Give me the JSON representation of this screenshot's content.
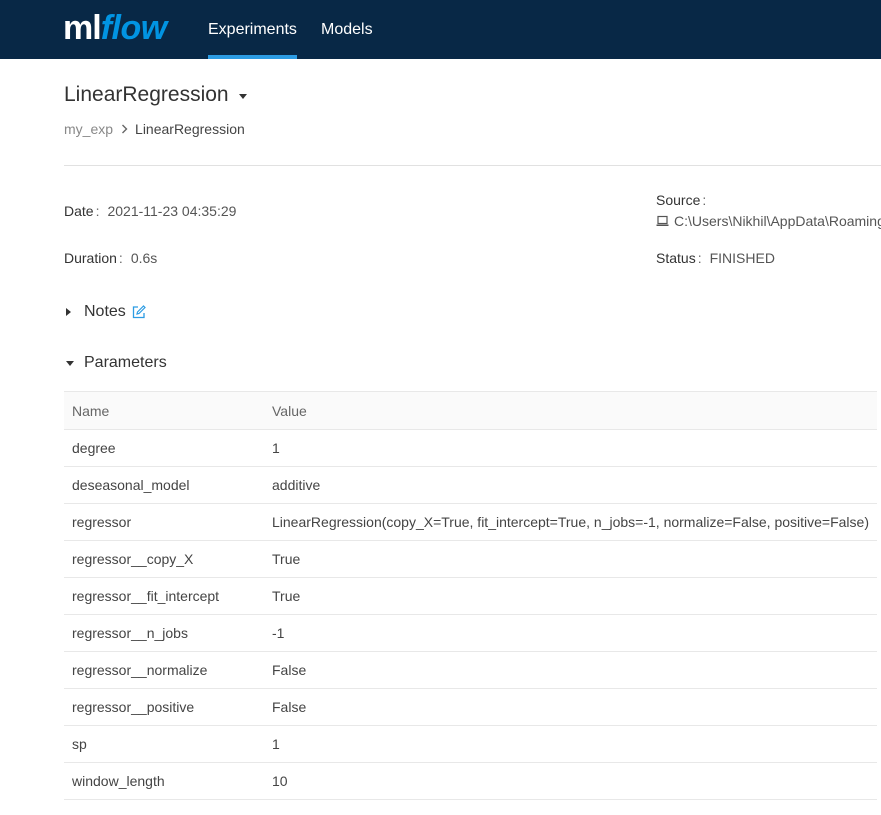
{
  "header": {
    "logo_ml": "ml",
    "logo_flow": "flow",
    "nav": [
      {
        "label": "Experiments",
        "active": true
      },
      {
        "label": "Models",
        "active": false
      }
    ],
    "bg_color": "#082846",
    "accent_color": "#2c9ce3"
  },
  "run": {
    "title": "LinearRegression",
    "breadcrumb": {
      "parent": "my_exp",
      "current": "LinearRegression"
    }
  },
  "metadata": {
    "date_label": "Date",
    "date_value": "2021-11-23 04:35:29",
    "duration_label": "Duration",
    "duration_value": "0.6s",
    "source_label": "Source",
    "source_value": "C:\\Users\\Nikhil\\AppData\\Roaming",
    "status_label": "Status",
    "status_value": "FINISHED",
    "separator": ":"
  },
  "sections": {
    "notes_label": "Notes",
    "parameters_label": "Parameters"
  },
  "parameters": {
    "columns": [
      "Name",
      "Value"
    ],
    "rows": [
      {
        "name": "degree",
        "value": "1"
      },
      {
        "name": "deseasonal_model",
        "value": "additive"
      },
      {
        "name": "regressor",
        "value": "LinearRegression(copy_X=True, fit_intercept=True, n_jobs=-1, normalize=False, positive=False)"
      },
      {
        "name": "regressor__copy_X",
        "value": "True"
      },
      {
        "name": "regressor__fit_intercept",
        "value": "True"
      },
      {
        "name": "regressor__n_jobs",
        "value": "-1"
      },
      {
        "name": "regressor__normalize",
        "value": "False"
      },
      {
        "name": "regressor__positive",
        "value": "False"
      },
      {
        "name": "sp",
        "value": "1"
      },
      {
        "name": "window_length",
        "value": "10"
      }
    ]
  },
  "icons": {
    "edit": "edit-icon",
    "laptop": "laptop-icon",
    "caret": "caret-down-icon",
    "chevron": "chevron-right-icon"
  }
}
